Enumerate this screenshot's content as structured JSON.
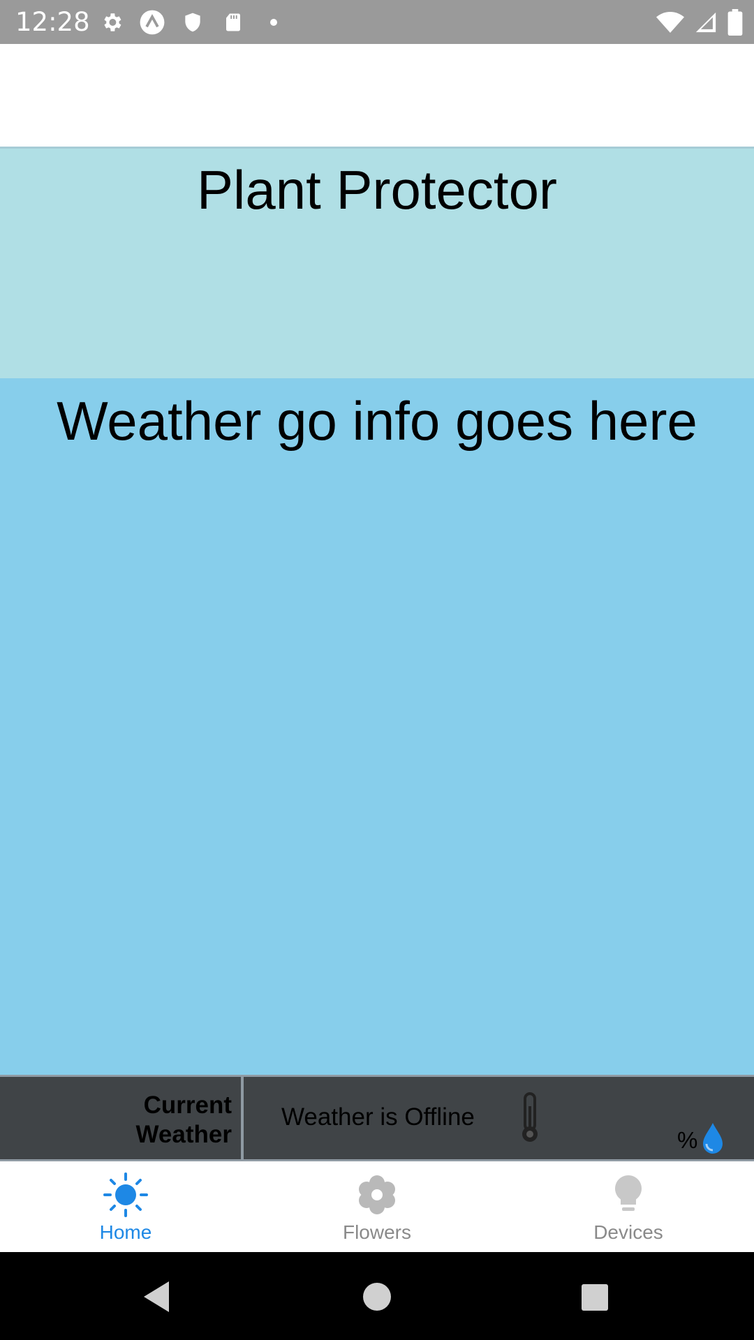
{
  "status_bar": {
    "time": "12:28",
    "left_icons": [
      "gear-icon",
      "expo-icon",
      "shield-icon",
      "sd-card-icon",
      "dot-icon"
    ],
    "right_icons": [
      "wifi-icon",
      "cellular-icon",
      "battery-icon"
    ]
  },
  "app": {
    "title": "Plant Protector",
    "weather_placeholder": "Weather go info goes here"
  },
  "weather_bar": {
    "label_line1": "Current",
    "label_line2": "Weather",
    "status": "Weather is Offline",
    "humidity_value": "%",
    "icons": [
      "thermometer-icon",
      "water-drop-icon"
    ]
  },
  "bottom_nav": {
    "items": [
      {
        "label": "Home",
        "icon": "sun-icon",
        "active": true
      },
      {
        "label": "Flowers",
        "icon": "flower-icon",
        "active": false
      },
      {
        "label": "Devices",
        "icon": "lightbulb-icon",
        "active": false
      }
    ]
  },
  "colors": {
    "title_panel": "#b0dfe5",
    "weather_panel": "#87ceeb",
    "weather_bar": "#404447",
    "active_tab": "#1e88e5",
    "inactive_tab": "#8a8a8a"
  }
}
